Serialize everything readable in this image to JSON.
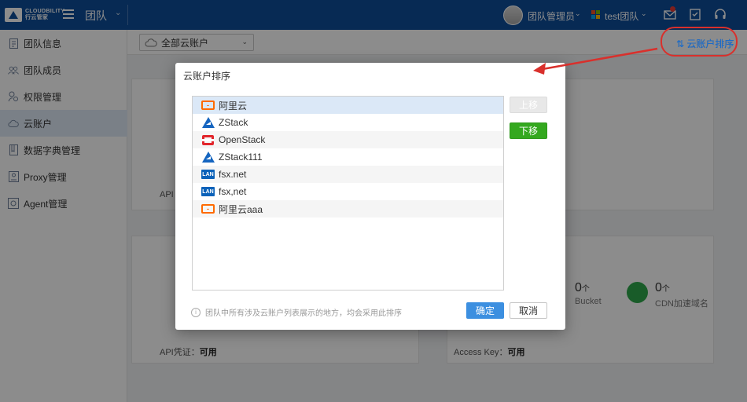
{
  "topbar": {
    "logo_text_line1": "CLOUDBILITY",
    "logo_text_line2": "行云管家",
    "section_title": "团队",
    "user_name": "团队管理员",
    "team_name": "test团队",
    "icons": [
      "hamburger-icon",
      "mail-icon",
      "checklist-icon",
      "headset-icon"
    ]
  },
  "sidebar": {
    "items": [
      {
        "label": "团队信息",
        "icon": "document-icon"
      },
      {
        "label": "团队成员",
        "icon": "users-icon"
      },
      {
        "label": "权限管理",
        "icon": "user-key-icon"
      },
      {
        "label": "云账户",
        "icon": "cloud-icon",
        "active": true
      },
      {
        "label": "数据字典管理",
        "icon": "book-icon"
      },
      {
        "label": "Proxy管理",
        "icon": "proxy-icon"
      },
      {
        "label": "Agent管理",
        "icon": "agent-icon"
      }
    ]
  },
  "filter": {
    "account_select_value": "全部云账户",
    "sort_link_label": "云账户排序"
  },
  "background": {
    "card1_api": "API",
    "card3_api_label": "API凭证：",
    "card3_api_value": "可用",
    "card4_key_label": "Access Key：",
    "card4_key_value": "可用",
    "bucket_count": "0",
    "bucket_unit": "个",
    "bucket_label": "Bucket",
    "cdn_count": "0",
    "cdn_unit": "个",
    "cdn_label": "CDN加速域名"
  },
  "modal": {
    "title": "云账户排序",
    "accounts": [
      {
        "name": "阿里云",
        "icon": "aliyun-icon"
      },
      {
        "name": "ZStack",
        "icon": "zstack-icon"
      },
      {
        "name": "OpenStack",
        "icon": "openstack-icon"
      },
      {
        "name": "ZStack111",
        "icon": "zstack-icon"
      },
      {
        "name": "fsx.net",
        "icon": "lan-icon"
      },
      {
        "name": "fsx,net",
        "icon": "lan-icon"
      },
      {
        "name": "阿里云aaa",
        "icon": "aliyun-icon"
      }
    ],
    "selected_index": 0,
    "move_up_label": "上移",
    "move_down_label": "下移",
    "hint_text": "团队中所有涉及云账户列表展示的地方，均会采用此排序",
    "confirm_label": "确定",
    "cancel_label": "取消"
  },
  "colors": {
    "topbar": "#0d4d9a",
    "link": "#1c6fd1",
    "move_down": "#34a81f",
    "confirm": "#3c8fe0",
    "annotation_red": "#d9302c"
  }
}
